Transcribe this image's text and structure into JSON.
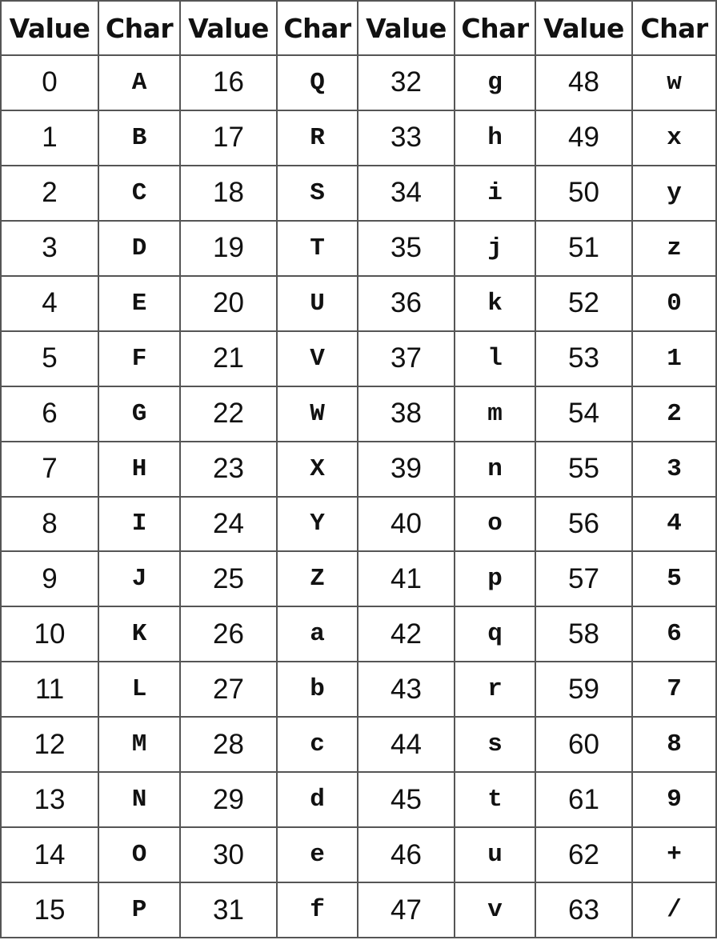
{
  "table": {
    "headers": [
      "Value",
      "Char",
      "Value",
      "Char",
      "Value",
      "Char",
      "Value",
      "Char"
    ],
    "rows": [
      [
        "0",
        "A",
        "16",
        "Q",
        "32",
        "g",
        "48",
        "w"
      ],
      [
        "1",
        "B",
        "17",
        "R",
        "33",
        "h",
        "49",
        "x"
      ],
      [
        "2",
        "C",
        "18",
        "S",
        "34",
        "i",
        "50",
        "y"
      ],
      [
        "3",
        "D",
        "19",
        "T",
        "35",
        "j",
        "51",
        "z"
      ],
      [
        "4",
        "E",
        "20",
        "U",
        "36",
        "k",
        "52",
        "0"
      ],
      [
        "5",
        "F",
        "21",
        "V",
        "37",
        "l",
        "53",
        "1"
      ],
      [
        "6",
        "G",
        "22",
        "W",
        "38",
        "m",
        "54",
        "2"
      ],
      [
        "7",
        "H",
        "23",
        "X",
        "39",
        "n",
        "55",
        "3"
      ],
      [
        "8",
        "I",
        "24",
        "Y",
        "40",
        "o",
        "56",
        "4"
      ],
      [
        "9",
        "J",
        "25",
        "Z",
        "41",
        "p",
        "57",
        "5"
      ],
      [
        "10",
        "K",
        "26",
        "a",
        "42",
        "q",
        "58",
        "6"
      ],
      [
        "11",
        "L",
        "27",
        "b",
        "43",
        "r",
        "59",
        "7"
      ],
      [
        "12",
        "M",
        "28",
        "c",
        "44",
        "s",
        "60",
        "8"
      ],
      [
        "13",
        "N",
        "29",
        "d",
        "45",
        "t",
        "61",
        "9"
      ],
      [
        "14",
        "O",
        "30",
        "e",
        "46",
        "u",
        "62",
        "+"
      ],
      [
        "15",
        "P",
        "31",
        "f",
        "47",
        "v",
        "63",
        "/"
      ]
    ]
  }
}
